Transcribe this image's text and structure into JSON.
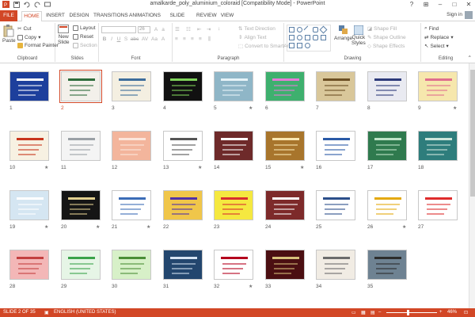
{
  "window": {
    "title": "amalkarde_poly_aluminium_coloraid [Compatibility Mode] - PowerPoint",
    "controls": [
      "?",
      "⊞",
      "–",
      "□",
      "✕"
    ]
  },
  "tabs": [
    "FILE",
    "HOME",
    "INSERT",
    "DESIGN",
    "TRANSITIONS",
    "ANIMATIONS",
    "SLIDE SHOW",
    "REVIEW",
    "VIEW"
  ],
  "active_tab": "HOME",
  "account": {
    "sign_in": "Sign in"
  },
  "ribbon": {
    "clipboard": {
      "paste": "Paste",
      "cut": "Cut",
      "copy": "Copy",
      "format_painter": "Format Painter",
      "label": "Clipboard"
    },
    "slides": {
      "new_slide": "New",
      "new_slide_2": "Slide",
      "layout": "Layout",
      "reset": "Reset",
      "section": "Section",
      "label": "Slides"
    },
    "font": {
      "font_size": "26",
      "label": "Font",
      "format_buttons": [
        "B",
        "I",
        "U",
        "S",
        "abc",
        "AV",
        "Aa",
        "A"
      ]
    },
    "paragraph": {
      "text_direction": "Text Direction",
      "align_text": "Align Text",
      "convert_smartart": "Convert to SmartArt",
      "label": "Paragraph"
    },
    "drawing": {
      "arrange": "Arrange",
      "quick_styles": "Quick",
      "quick_styles_2": "Styles",
      "shape_fill": "Shape Fill",
      "shape_outline": "Shape Outline",
      "shape_effects": "Shape Effects",
      "label": "Drawing"
    },
    "editing": {
      "find": "Find",
      "replace": "Replace",
      "select": "Select",
      "label": "Editing"
    }
  },
  "slides": [
    {
      "n": "1",
      "bg": "#1d3f9c",
      "accent": "#ffffff",
      "star": false
    },
    {
      "n": "2",
      "bg": "#f3f0ea",
      "accent": "#2d6c3b",
      "star": false
    },
    {
      "n": "3",
      "bg": "#f4efe1",
      "accent": "#3d6d9b",
      "star": false
    },
    {
      "n": "4",
      "bg": "#111111",
      "accent": "#7fd25a",
      "star": false
    },
    {
      "n": "5",
      "bg": "#8fb6c7",
      "accent": "#e7f3f7",
      "star": true
    },
    {
      "n": "6",
      "bg": "#3eb06e",
      "accent": "#e47bd7",
      "star": false
    },
    {
      "n": "7",
      "bg": "#d9c79a",
      "accent": "#6b4f24",
      "star": false
    },
    {
      "n": "8",
      "bg": "#e9eaf1",
      "accent": "#2d3a7a",
      "star": false
    },
    {
      "n": "9",
      "bg": "#f6e7ad",
      "accent": "#e06d8e",
      "star": true
    },
    {
      "n": "10",
      "bg": "#f7f1e2",
      "accent": "#c8351c",
      "star": true
    },
    {
      "n": "11",
      "bg": "#f4f4f4",
      "accent": "#9aa0a6",
      "star": false
    },
    {
      "n": "12",
      "bg": "#f3b59c",
      "accent": "#fce6dc",
      "star": false
    },
    {
      "n": "13",
      "bg": "#ffffff",
      "accent": "#555555",
      "star": true
    },
    {
      "n": "14",
      "bg": "#6e2a2a",
      "accent": "#ffffff",
      "star": false
    },
    {
      "n": "15",
      "bg": "#a8752c",
      "accent": "#f9e7b3",
      "star": true
    },
    {
      "n": "16",
      "bg": "#ffffff",
      "accent": "#2a5aa6",
      "star": false
    },
    {
      "n": "17",
      "bg": "#2f7a4e",
      "accent": "#bfe3c8",
      "star": false
    },
    {
      "n": "18",
      "bg": "#2e7d7c",
      "accent": "#cfe6dc",
      "star": false
    },
    {
      "n": "19",
      "bg": "#d5e6f2",
      "accent": "#ffffff",
      "star": true
    },
    {
      "n": "20",
      "bg": "#151515",
      "accent": "#e2cf8f",
      "star": true
    },
    {
      "n": "21",
      "bg": "#ffffff",
      "accent": "#3c6db7",
      "star": true
    },
    {
      "n": "22",
      "bg": "#f0c64a",
      "accent": "#5032a8",
      "star": false
    },
    {
      "n": "23",
      "bg": "#f5e840",
      "accent": "#d72f2f",
      "star": false
    },
    {
      "n": "24",
      "bg": "#7d2a2a",
      "accent": "#ffffff",
      "star": false
    },
    {
      "n": "25",
      "bg": "#ffffff",
      "accent": "#2c4f8a",
      "star": false
    },
    {
      "n": "26",
      "bg": "#ffffff",
      "accent": "#e4a90d",
      "star": true
    },
    {
      "n": "27",
      "bg": "#ffffff",
      "accent": "#df2c2c",
      "star": false
    },
    {
      "n": "28",
      "bg": "#f3b7b7",
      "accent": "#c33f3f",
      "star": false
    },
    {
      "n": "29",
      "bg": "#e6f5e6",
      "accent": "#3aa24a",
      "star": false
    },
    {
      "n": "30",
      "bg": "#d7f0c8",
      "accent": "#4a8e37",
      "star": false
    },
    {
      "n": "31",
      "bg": "#23466e",
      "accent": "#d6e3f3",
      "star": false
    },
    {
      "n": "32",
      "bg": "#ffffff",
      "accent": "#b4001d",
      "star": true
    },
    {
      "n": "33",
      "bg": "#4b0f12",
      "accent": "#d7c07a",
      "star": false
    },
    {
      "n": "34",
      "bg": "#f1ece4",
      "accent": "#6b6b6b",
      "star": false
    },
    {
      "n": "35",
      "bg": "#6e8292",
      "accent": "#2c2c2c",
      "star": false
    }
  ],
  "selected_slide": "2",
  "status": {
    "slide_info": "SLIDE 2 OF 35",
    "language": "ENGLISH (UNITED STATES)",
    "zoom": "46%"
  },
  "colors": {
    "accent": "#d24726",
    "status_bar": "#d24726"
  }
}
